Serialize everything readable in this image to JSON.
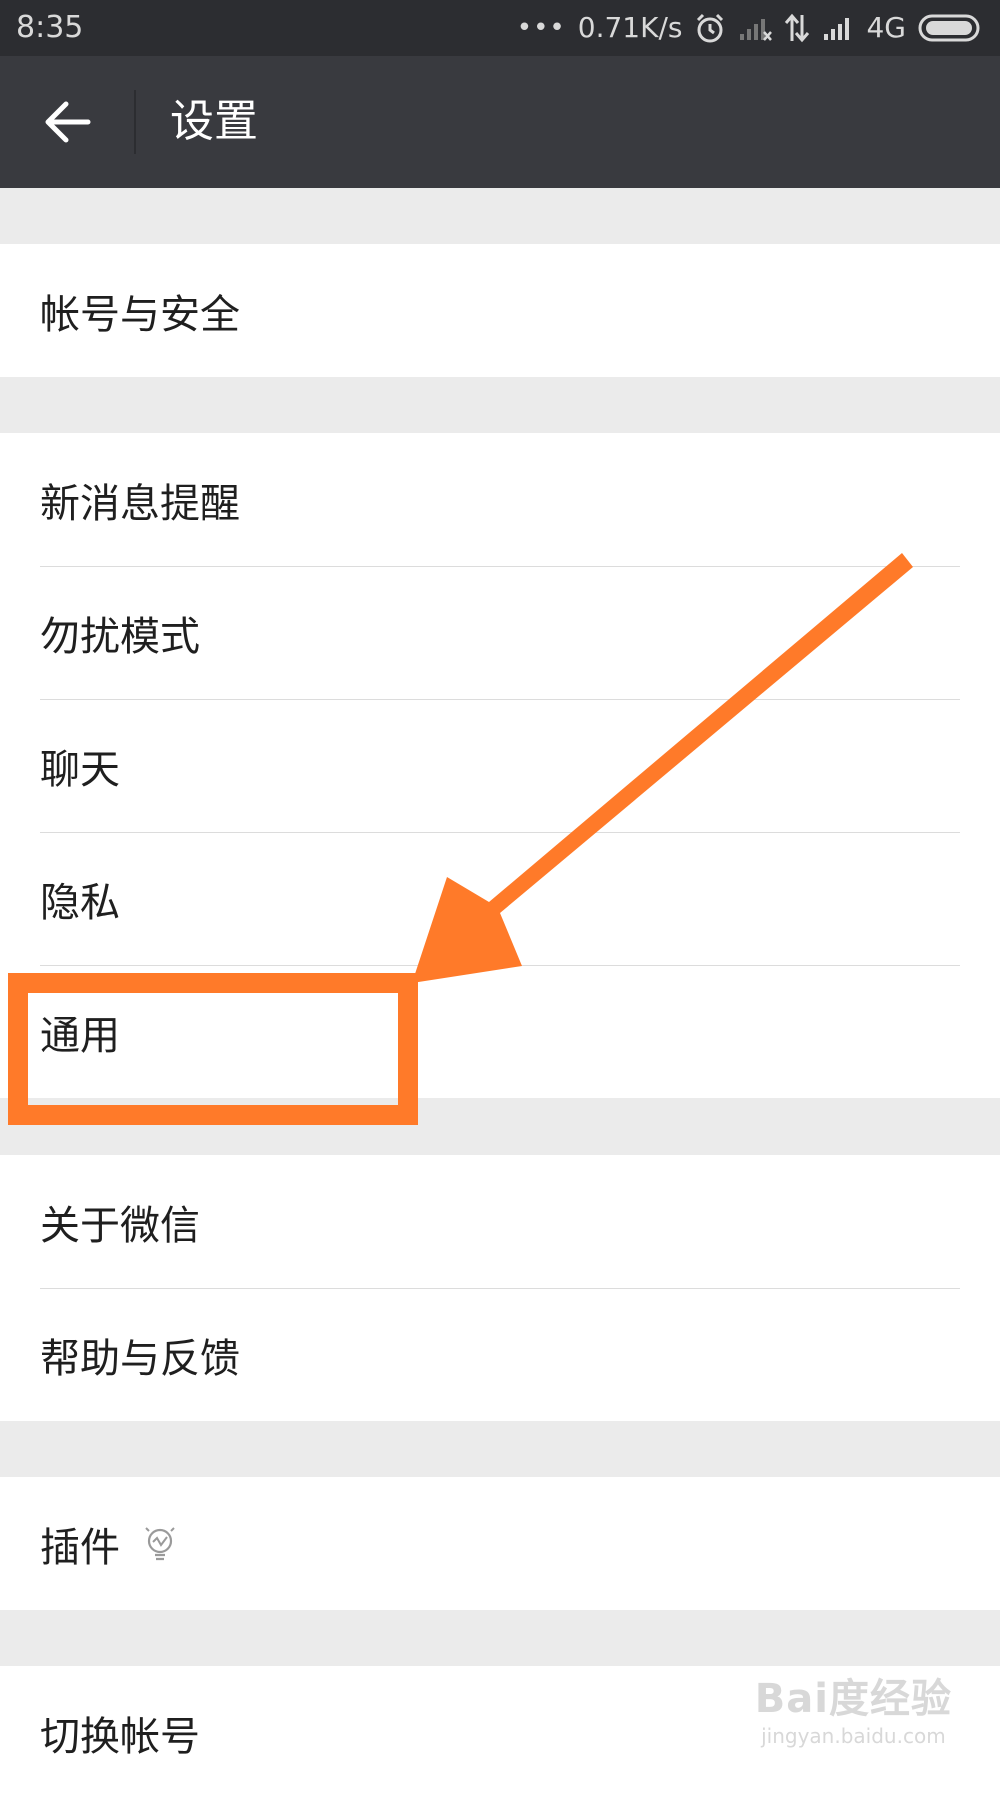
{
  "status_bar": {
    "time": "8:35",
    "speed": "0.71K/s",
    "network": "4G"
  },
  "nav": {
    "title": "设置"
  },
  "groups": [
    {
      "items": [
        {
          "label": "帐号与安全"
        }
      ]
    },
    {
      "items": [
        {
          "label": "新消息提醒"
        },
        {
          "label": "勿扰模式"
        },
        {
          "label": "聊天"
        },
        {
          "label": "隐私"
        },
        {
          "label": "通用",
          "highlighted": true
        }
      ]
    },
    {
      "items": [
        {
          "label": "关于微信"
        },
        {
          "label": "帮助与反馈"
        }
      ]
    },
    {
      "items": [
        {
          "label": "插件",
          "icon": "lightbulb-icon"
        }
      ]
    },
    {
      "items": [
        {
          "label": "切换帐号"
        }
      ]
    }
  ],
  "watermark": {
    "brand": "Bai度经验",
    "url": "jingyan.baidu.com"
  },
  "colors": {
    "status_bar": "#2c2d31",
    "nav_bar": "#393a3f",
    "background": "#ebebeb",
    "annotation": "#ff7a29"
  }
}
